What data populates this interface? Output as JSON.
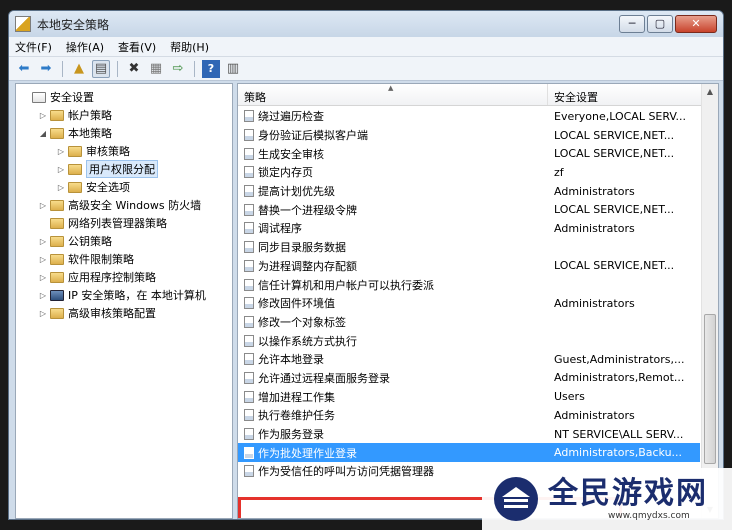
{
  "window": {
    "title": "本地安全策略",
    "buttons": {
      "minimize": "─",
      "maximize": "▢",
      "close": "✕"
    }
  },
  "menu": [
    "文件(F)",
    "操作(A)",
    "查看(V)",
    "帮助(H)"
  ],
  "toolbar": [
    "back-icon",
    "forward-icon",
    "up-folder-icon",
    "show-tree-icon",
    "delete-icon",
    "properties-icon",
    "export-icon",
    "help-icon",
    "console-tree-icon"
  ],
  "tree": [
    {
      "label": "安全设置",
      "arrow": "",
      "icon": "doc",
      "depth": 0
    },
    {
      "label": "帐户策略",
      "arrow": "▷",
      "icon": "folder",
      "depth": 1
    },
    {
      "label": "本地策略",
      "arrow": "◢",
      "icon": "folder",
      "depth": 1
    },
    {
      "label": "审核策略",
      "arrow": "▷",
      "icon": "folder",
      "depth": 2
    },
    {
      "label": "用户权限分配",
      "arrow": "▷",
      "icon": "folder",
      "depth": 2,
      "selected": true
    },
    {
      "label": "安全选项",
      "arrow": "▷",
      "icon": "folder",
      "depth": 2
    },
    {
      "label": "高级安全 Windows 防火墙",
      "arrow": "▷",
      "icon": "folder",
      "depth": 1
    },
    {
      "label": "网络列表管理器策略",
      "arrow": "",
      "icon": "folder",
      "depth": 1
    },
    {
      "label": "公钥策略",
      "arrow": "▷",
      "icon": "folder",
      "depth": 1
    },
    {
      "label": "软件限制策略",
      "arrow": "▷",
      "icon": "folder",
      "depth": 1
    },
    {
      "label": "应用程序控制策略",
      "arrow": "▷",
      "icon": "folder",
      "depth": 1
    },
    {
      "label": "IP 安全策略，在 本地计算机",
      "arrow": "▷",
      "icon": "pc",
      "depth": 1
    },
    {
      "label": "高级审核策略配置",
      "arrow": "▷",
      "icon": "folder",
      "depth": 1
    }
  ],
  "list": {
    "columns": {
      "policy": "策略",
      "setting": "安全设置"
    },
    "rows": [
      {
        "policy": "绕过遍历检查",
        "setting": "Everyone,LOCAL SERV..."
      },
      {
        "policy": "身份验证后模拟客户端",
        "setting": "LOCAL SERVICE,NET..."
      },
      {
        "policy": "生成安全审核",
        "setting": "LOCAL SERVICE,NET..."
      },
      {
        "policy": "锁定内存页",
        "setting": "zf"
      },
      {
        "policy": "提高计划优先级",
        "setting": "Administrators"
      },
      {
        "policy": "替换一个进程级令牌",
        "setting": "LOCAL SERVICE,NET..."
      },
      {
        "policy": "调试程序",
        "setting": "Administrators"
      },
      {
        "policy": "同步目录服务数据",
        "setting": ""
      },
      {
        "policy": "为进程调整内存配额",
        "setting": "LOCAL SERVICE,NET..."
      },
      {
        "policy": "信任计算机和用户帐户可以执行委派",
        "setting": ""
      },
      {
        "policy": "修改固件环境值",
        "setting": "Administrators"
      },
      {
        "policy": "修改一个对象标签",
        "setting": ""
      },
      {
        "policy": "以操作系统方式执行",
        "setting": ""
      },
      {
        "policy": "允许本地登录",
        "setting": "Guest,Administrators,..."
      },
      {
        "policy": "允许通过远程桌面服务登录",
        "setting": "Administrators,Remot..."
      },
      {
        "policy": "增加进程工作集",
        "setting": "Users"
      },
      {
        "policy": "执行卷维护任务",
        "setting": "Administrators"
      },
      {
        "policy": "作为服务登录",
        "setting": "NT SERVICE\\ALL SERV..."
      },
      {
        "policy": "作为批处理作业登录",
        "setting": "Administrators,Backu...",
        "selected": true
      },
      {
        "policy": "作为受信任的呼叫方访问凭据管理器",
        "setting": ""
      }
    ]
  },
  "watermark": {
    "name": "全民游戏网",
    "url": "www.qmydxs.com"
  }
}
